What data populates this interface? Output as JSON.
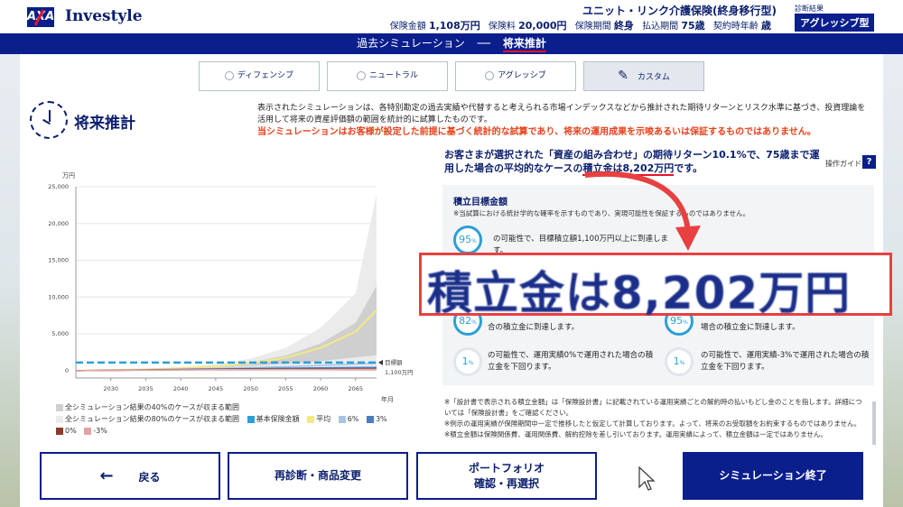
{
  "header": {
    "brand": "Investyle",
    "logo_text": "AXA",
    "product_title": "ユニット・リンク介護保険(終身移行型)",
    "meta": [
      {
        "label": "保険金額",
        "value": "1,108万円"
      },
      {
        "label": "保険料",
        "value": "20,000円"
      },
      {
        "label": "保険期間",
        "value": "終身"
      },
      {
        "label": "払込期間",
        "value": "75歳"
      },
      {
        "label": "契約時年齢",
        "value": "歳"
      }
    ],
    "diag_label": "診断結果",
    "diag_value": "アグレッシブ型"
  },
  "nav": {
    "past": "過去シミュレーション",
    "separator": "──",
    "future": "将来推計"
  },
  "tabs": [
    {
      "label": "ディフェンシブ",
      "selected": false
    },
    {
      "label": "ニュートラル",
      "selected": false
    },
    {
      "label": "アグレッシブ",
      "selected": false
    },
    {
      "label": "カスタム",
      "selected": true
    }
  ],
  "section": {
    "title": "将来推計",
    "intro": "表示されたシミュレーションは、各特別勘定の過去実績や代替すると考えられる市場インデックスなどから推計された期待リターンとリスク水準に基づき、投資理論を活用して将来の資産評価額の範囲を統計的に試算したものです。",
    "warning": "当シミュレーションはお客様が設定した前提に基づく統計的な試算であり、将来の運用成果を示唆あるいは保証するものではありません。"
  },
  "summary": {
    "text_before": "お客さまが選択された「資産の組み合わせ」の期待リターン10.1%で、75歳まで運用した場合の平均的なケースの",
    "highlight": "積立金は8,202万円",
    "text_after": "です。",
    "guide_label": "操作ガイド",
    "guide_q": "?"
  },
  "target": {
    "title": "積立目標金額",
    "note": "※当試算における統計学的な確率を示すものであり、実現可能性を保証するものではありません。",
    "probs": [
      {
        "pct": "95",
        "text": "の可能性で、目標積立額1,100万円以上に到達します。"
      },
      {
        "pct": "82",
        "text": "合の積立金に到達します。"
      },
      {
        "pct": "95",
        "text": "場合の積立金に到達します。"
      },
      {
        "pct": "1",
        "text": "の可能性で、運用実績0%で運用された場合の積立金を下回ります。"
      },
      {
        "pct": "1",
        "text": "の可能性で、運用実績-3%で運用された場合の積立金を下回ります。"
      }
    ],
    "pct_unit": "%"
  },
  "zoom_text": "積立金は8,202万円",
  "notes": [
    "※「設計書で表示される積立金額」は「保険設計書」に記載されている運用実績ごとの解約時の払いもどし金のことを指します。詳細については「保険設計書」をご確認ください。",
    "※例示の運用実績が保険期間中一定で推移したと仮定して計算しております。よって、将来のお受取額をお約束するものではありません。",
    "※積立金額は保険関係費、運用関係費、解約控除を差し引いております。運用実績によって、積立金額は一定ではありません。"
  ],
  "chart_data": {
    "type": "area",
    "yunit": "万円",
    "xunit": "年月",
    "x": [
      2025,
      2030,
      2035,
      2040,
      2045,
      2050,
      2055,
      2060,
      2065,
      2068
    ],
    "xticks": [
      "2030",
      "2035",
      "2040",
      "2045",
      "2050",
      "2055",
      "2060",
      "2065"
    ],
    "yticks": [
      "0",
      "5,000",
      "10,000",
      "15,000",
      "20,000",
      "25,000"
    ],
    "ylim": [
      -1000,
      25000
    ],
    "bands": [
      {
        "name": "全シミュレーション結果の80%のケースが収まる範囲",
        "color": "#ebebeb",
        "low": [
          0,
          50,
          110,
          170,
          220,
          270,
          320,
          360,
          400,
          420
        ],
        "high": [
          0,
          120,
          260,
          480,
          880,
          1650,
          3100,
          5800,
          10500,
          24000
        ]
      },
      {
        "name": "全シミュレーション結果の40%のケースが収まる範囲",
        "color": "#cfcfcf",
        "low": [
          0,
          70,
          150,
          260,
          430,
          650,
          950,
          1300,
          1800,
          2100
        ],
        "high": [
          0,
          90,
          200,
          360,
          640,
          1150,
          2050,
          3700,
          6500,
          11500
        ]
      }
    ],
    "series": [
      {
        "name": "平均",
        "color": "#f2ea80",
        "values": [
          0,
          80,
          180,
          320,
          560,
          1000,
          1750,
          3100,
          5300,
          8202
        ]
      },
      {
        "name": "6%",
        "color": "#a9c4e0",
        "values": [
          0,
          60,
          130,
          210,
          300,
          410,
          540,
          700,
          900,
          1000
        ]
      },
      {
        "name": "3%",
        "color": "#4a7cc0",
        "values": [
          0,
          50,
          110,
          170,
          225,
          280,
          330,
          380,
          420,
          440
        ]
      },
      {
        "name": "0%",
        "color": "#8b3a2a",
        "values": [
          0,
          45,
          90,
          135,
          165,
          190,
          205,
          215,
          220,
          220
        ]
      },
      {
        "name": "-3%",
        "color": "#e3a3a3",
        "values": [
          0,
          40,
          80,
          110,
          130,
          140,
          145,
          145,
          140,
          135
        ]
      }
    ],
    "reference": {
      "name": "基本保険金額",
      "color": "#2a9fd8",
      "value": 1100,
      "label": "目標額",
      "sublabel": "1,100万円"
    }
  },
  "buttons": {
    "back": "戻る",
    "rediagnose": "再診断・商品変更",
    "portfolio_1": "ポートフォリオ",
    "portfolio_2": "確認・再選択",
    "finish": "シミュレーション終了"
  }
}
